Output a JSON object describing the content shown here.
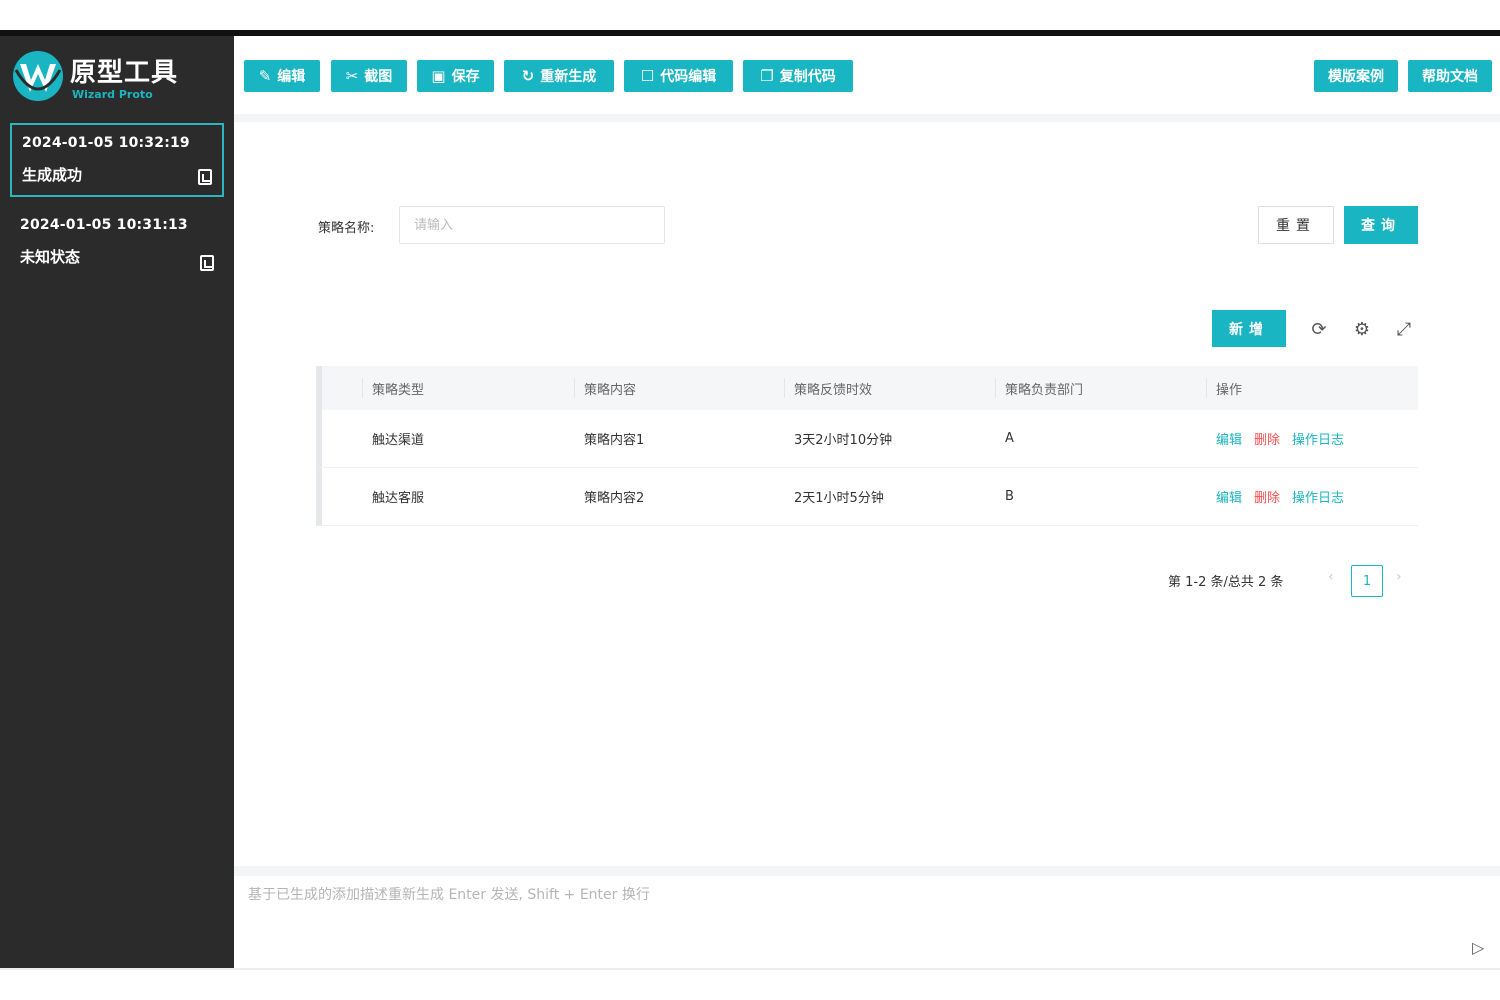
{
  "app": {
    "title": "原型工具",
    "subtitle": "Wizard Proto",
    "brand_color": "#19b5c2"
  },
  "history": [
    {
      "time": "2024-01-05 10:32:19",
      "status": "生成成功",
      "icon": "document-icon"
    },
    {
      "time": "2024-01-05 10:31:13",
      "status": "未知状态",
      "icon": "document-icon"
    }
  ],
  "toolbar": {
    "edit": "编辑",
    "screenshot": "截图",
    "save": "保存",
    "regenerate": "重新生成",
    "code_edit": "代码编辑",
    "copy_code": "复制代码",
    "template": "模版案例",
    "help": "帮助文档"
  },
  "search": {
    "label": "策略名称:",
    "placeholder": "请输入",
    "reset": "重置",
    "query": "查询"
  },
  "table_tools": {
    "add": "新增"
  },
  "table": {
    "columns": [
      "策略类型",
      "策略内容",
      "策略反馈时效",
      "策略负责部门",
      "操作"
    ],
    "rows": [
      {
        "type": "触达渠道",
        "content": "策略内容1",
        "time": "3天2小时10分钟",
        "dept": "A"
      },
      {
        "type": "触达客服",
        "content": "策略内容2",
        "time": "2天1小时5分钟",
        "dept": "B"
      }
    ],
    "actions": {
      "edit": "编辑",
      "delete": "删除",
      "log": "操作日志"
    }
  },
  "pagination": {
    "summary": "第 1-2 条/总共 2 条",
    "current": "1"
  },
  "chat": {
    "placeholder": "基于已生成的添加描述重新生成 Enter 发送, Shift + Enter 换行"
  }
}
